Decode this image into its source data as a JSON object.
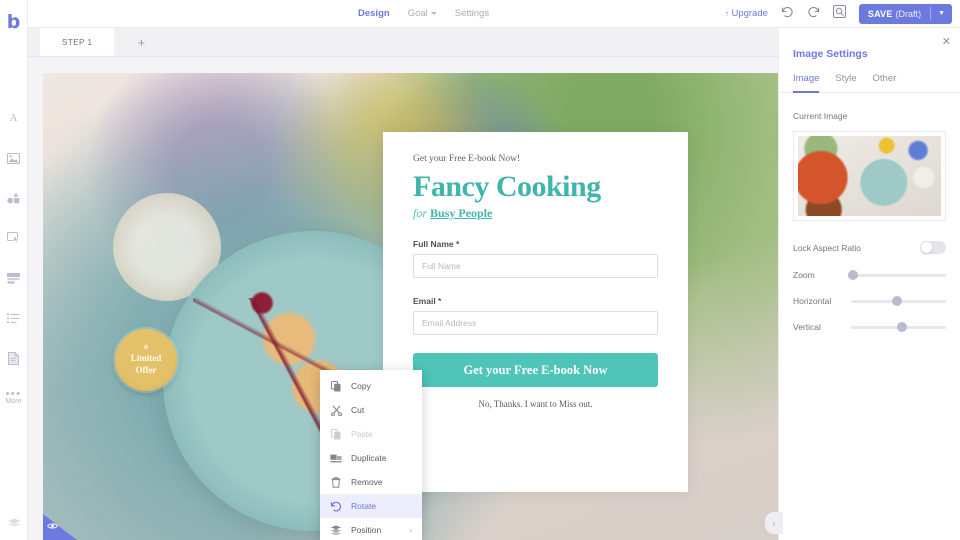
{
  "brand": {
    "logo_text": "b",
    "accent": "#6c7ae0"
  },
  "topbar": {
    "nav": [
      {
        "label": "Design",
        "active": true
      },
      {
        "label": "Goal",
        "active": false,
        "has_caret": true
      },
      {
        "label": "Settings",
        "active": false
      }
    ],
    "upgrade_label": "Upgrade",
    "upgrade_arrow": "↑",
    "icons": [
      {
        "name": "undo-icon",
        "glyph": "↺"
      },
      {
        "name": "redo-icon",
        "glyph": "↻"
      },
      {
        "name": "preview-icon",
        "glyph": "⌕"
      }
    ],
    "save": {
      "label": "SAVE",
      "state": "(Draft)",
      "caret": "▼"
    }
  },
  "steps": {
    "tabs": [
      {
        "label": "STEP 1",
        "active": true
      }
    ],
    "add_label": "+"
  },
  "sidebar": {
    "items": [
      {
        "name": "text-icon",
        "label": "",
        "glyph": "A"
      },
      {
        "name": "image-icon",
        "label": ""
      },
      {
        "name": "shapes-icon",
        "label": ""
      },
      {
        "name": "button-icon",
        "label": ""
      },
      {
        "name": "form-icon",
        "label": ""
      },
      {
        "name": "list-icon",
        "label": ""
      },
      {
        "name": "page-icon",
        "label": ""
      },
      {
        "name": "more-icon",
        "label": "More"
      }
    ]
  },
  "page": {
    "eyebrow": "Get your Free E-book Now!",
    "headline": "Fancy Cooking",
    "sub_prefix": "for",
    "sub_link": "Busy People",
    "fields": [
      {
        "label": "Full Name *",
        "placeholder": "Full Name",
        "value": ""
      },
      {
        "label": "Email *",
        "placeholder": "Email Address",
        "value": ""
      }
    ],
    "cta_label": "Get your Free E-book Now",
    "decline_label": "No, Thanks. I want to Miss out.",
    "badge": {
      "star": "★",
      "line1": "Limited",
      "line2": "Offer"
    }
  },
  "context_menu": {
    "items": [
      {
        "label": "Copy",
        "icon": "copy-icon",
        "state": "normal"
      },
      {
        "label": "Cut",
        "icon": "cut-icon",
        "state": "normal"
      },
      {
        "label": "Paste",
        "icon": "paste-icon",
        "state": "disabled"
      },
      {
        "label": "Duplicate",
        "icon": "duplicate-icon",
        "state": "normal"
      },
      {
        "label": "Remove",
        "icon": "trash-icon",
        "state": "normal"
      },
      {
        "label": "Rotate",
        "icon": "rotate-icon",
        "state": "active"
      },
      {
        "label": "Position",
        "icon": "layers-icon",
        "state": "submenu",
        "arrow": "›"
      }
    ]
  },
  "panel": {
    "title": "Image Settings",
    "close_glyph": "✕",
    "tabs": [
      {
        "label": "Image",
        "active": true
      },
      {
        "label": "Style",
        "active": false
      },
      {
        "label": "Other",
        "active": false
      }
    ],
    "current_image_label": "Current Image",
    "lock_aspect_label": "Lock Aspect Ratio",
    "lock_aspect_on": false,
    "sliders": [
      {
        "label": "Zoom",
        "percent": 2
      },
      {
        "label": "Horizontal",
        "percent": 48
      },
      {
        "label": "Vertical",
        "percent": 54
      }
    ],
    "collapse_glyph": "›"
  }
}
